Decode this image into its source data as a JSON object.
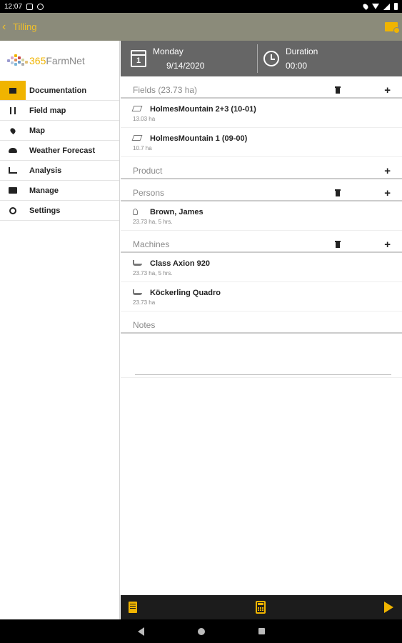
{
  "status_bar": {
    "time": "12:07"
  },
  "app_bar": {
    "back_glyph": "‹",
    "title": "Tilling"
  },
  "brand": {
    "logo_365": "365",
    "logo_rest": "FarmNet"
  },
  "sidebar": {
    "items": [
      {
        "label": "Documentation",
        "icon": "documentation-icon",
        "active": true
      },
      {
        "label": "Field map",
        "icon": "field-map-icon",
        "active": false
      },
      {
        "label": "Map",
        "icon": "map-pin-icon",
        "active": false
      },
      {
        "label": "Weather Forecast",
        "icon": "weather-icon",
        "active": false
      },
      {
        "label": "Analysis",
        "icon": "analysis-icon",
        "active": false
      },
      {
        "label": "Manage",
        "icon": "folder-icon",
        "active": false
      },
      {
        "label": "Settings",
        "icon": "settings-icon",
        "active": false
      }
    ]
  },
  "header": {
    "day": "Monday",
    "date": "9/14/2020",
    "calendar_number": "1",
    "duration_label": "Duration",
    "duration_value": "00:00"
  },
  "fields": {
    "title": "Fields (23.73 ha)",
    "items": [
      {
        "name": "HolmesMountain 2+3 (10-01)",
        "sub": "13.03 ha"
      },
      {
        "name": "HolmesMountain 1 (09-00)",
        "sub": "10.7 ha"
      }
    ]
  },
  "product": {
    "title": "Product"
  },
  "persons": {
    "title": "Persons",
    "items": [
      {
        "name": "Brown, James",
        "sub": "23.73 ha, 5 hrs."
      }
    ]
  },
  "machines": {
    "title": "Machines",
    "items": [
      {
        "name": "Class Axion 920",
        "sub": "23.73 ha, 5 hrs."
      },
      {
        "name": "Köckerling Quadro",
        "sub": "23.73 ha"
      }
    ]
  },
  "notes": {
    "title": "Notes",
    "value": ""
  },
  "colors": {
    "accent": "#f0b400",
    "appbar": "#8b8b7a",
    "header": "#666666",
    "bottombar": "#1c1c1c"
  }
}
